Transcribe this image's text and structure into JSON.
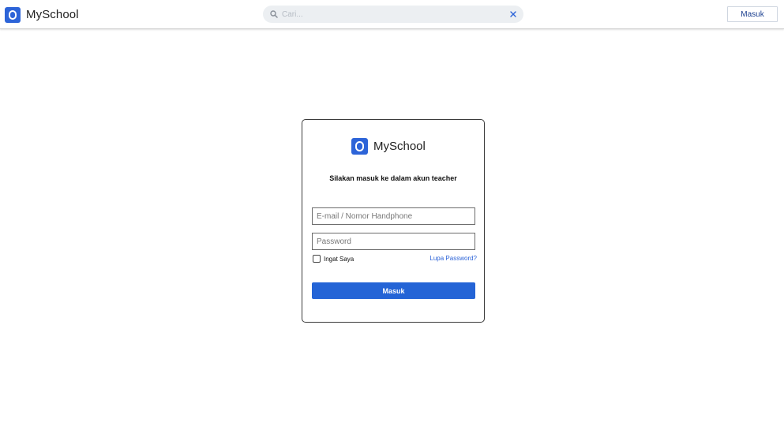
{
  "header": {
    "brand_name": "MySсhool",
    "search_placeholder": "Cari...",
    "login_button": "Masuk"
  },
  "login_card": {
    "brand_name": "MySсhool",
    "subtitle": "Silakan masuk ke dalam akun teacher",
    "email_placeholder": "E-mail / Nomor Handphone",
    "password_placeholder": "Password",
    "remember_label": "Ingat Saya",
    "forgot_link": "Lupa Password?",
    "submit_label": "Masuk"
  },
  "icons": {
    "logo": "myschool-logo-icon",
    "search": "search-icon",
    "clear": "close-icon"
  },
  "colors": {
    "brand_blue": "#2d64d8",
    "button_blue": "#2464d6",
    "search_bg": "#eceff2"
  }
}
